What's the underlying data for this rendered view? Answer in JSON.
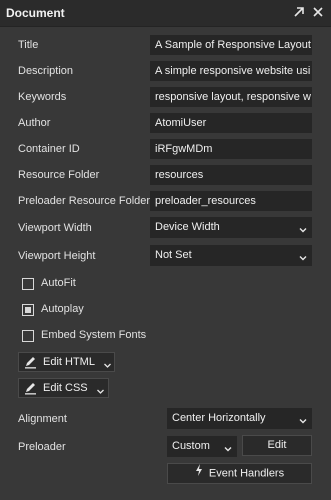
{
  "header": {
    "title": "Document"
  },
  "fields": [
    {
      "label": "Title",
      "value": "A Sample of Responsive Layout"
    },
    {
      "label": "Description",
      "value": "A simple responsive website usin"
    },
    {
      "label": "Keywords",
      "value": "responsive layout, responsive w"
    },
    {
      "label": "Author",
      "value": "AtomiUser"
    },
    {
      "label": "Container ID",
      "value": "iRFgwMDm"
    },
    {
      "label": "Resource Folder",
      "value": "resources"
    },
    {
      "label": "Preloader Resource Folder",
      "value": "preloader_resources"
    }
  ],
  "viewport": {
    "width_label": "Viewport Width",
    "width_value": "Device Width",
    "height_label": "Viewport Height",
    "height_value": "Not Set"
  },
  "checkboxes": [
    {
      "label": "AutoFit",
      "checked": false
    },
    {
      "label": "Autoplay",
      "checked": true
    },
    {
      "label": "Embed System Fonts",
      "checked": false
    }
  ],
  "code_buttons": {
    "edit_html": "Edit HTML",
    "edit_css": "Edit CSS"
  },
  "alignment": {
    "label": "Alignment",
    "value": "Center Horizontally"
  },
  "preloader": {
    "label": "Preloader",
    "value": "Custom",
    "edit_label": "Edit"
  },
  "event_handlers": {
    "label": "Event Handlers"
  },
  "icons": {
    "header_expand": "expand-icon",
    "header_close": "close-icon",
    "edit": "pencil-icon",
    "bolt": "lightning-icon",
    "dropdown": "chevron-down-icon"
  },
  "colors": {
    "panel_bg": "#383838",
    "header_bg": "#2b2b2b",
    "field_bg": "#262626",
    "text": "#e2e2e2"
  }
}
